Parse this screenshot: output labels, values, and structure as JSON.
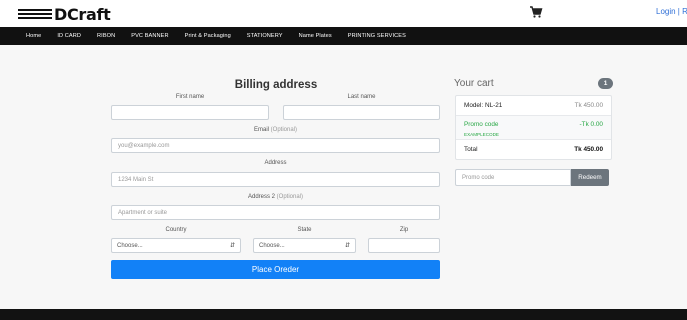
{
  "brand": {
    "name": "DCraft"
  },
  "header": {
    "login_text": "Login | Re"
  },
  "nav": {
    "items": [
      "Home",
      "ID CARD",
      "RIBON",
      "PVC BANNER",
      "Print & Packaging",
      "STATIONERY",
      "Name Plates",
      "PRINTING SERVICES"
    ]
  },
  "billing": {
    "title": "Billing address",
    "first_name_label": "First name",
    "last_name_label": "Last name",
    "email_label": "Email",
    "email_optional": "(Optional)",
    "email_placeholder": "you@example.com",
    "address_label": "Address",
    "address_placeholder": "1234 Main St",
    "address2_label": "Address 2",
    "address2_optional": "(Optional)",
    "address2_placeholder": "Apartment or suite",
    "country_label": "Country",
    "country_value": "Choose...",
    "state_label": "State",
    "state_value": "Choose...",
    "zip_label": "Zip",
    "submit_label": "Place Oreder"
  },
  "cart": {
    "title": "Your cart",
    "count": "1",
    "item_name": "Model: NL-21",
    "item_price": "Tk 450.00",
    "promo_label": "Promo code",
    "promo_code": "EXAMPLECODE",
    "promo_value": "-Tk 0.00",
    "total_label": "Total",
    "total_value": "Tk 450.00",
    "redeem_placeholder": "Promo code",
    "redeem_label": "Redeem"
  },
  "colors": {
    "accent": "#1281f7",
    "nav_bg": "#111111",
    "promo_green": "#28a745",
    "badge_gray": "#6c757d"
  }
}
